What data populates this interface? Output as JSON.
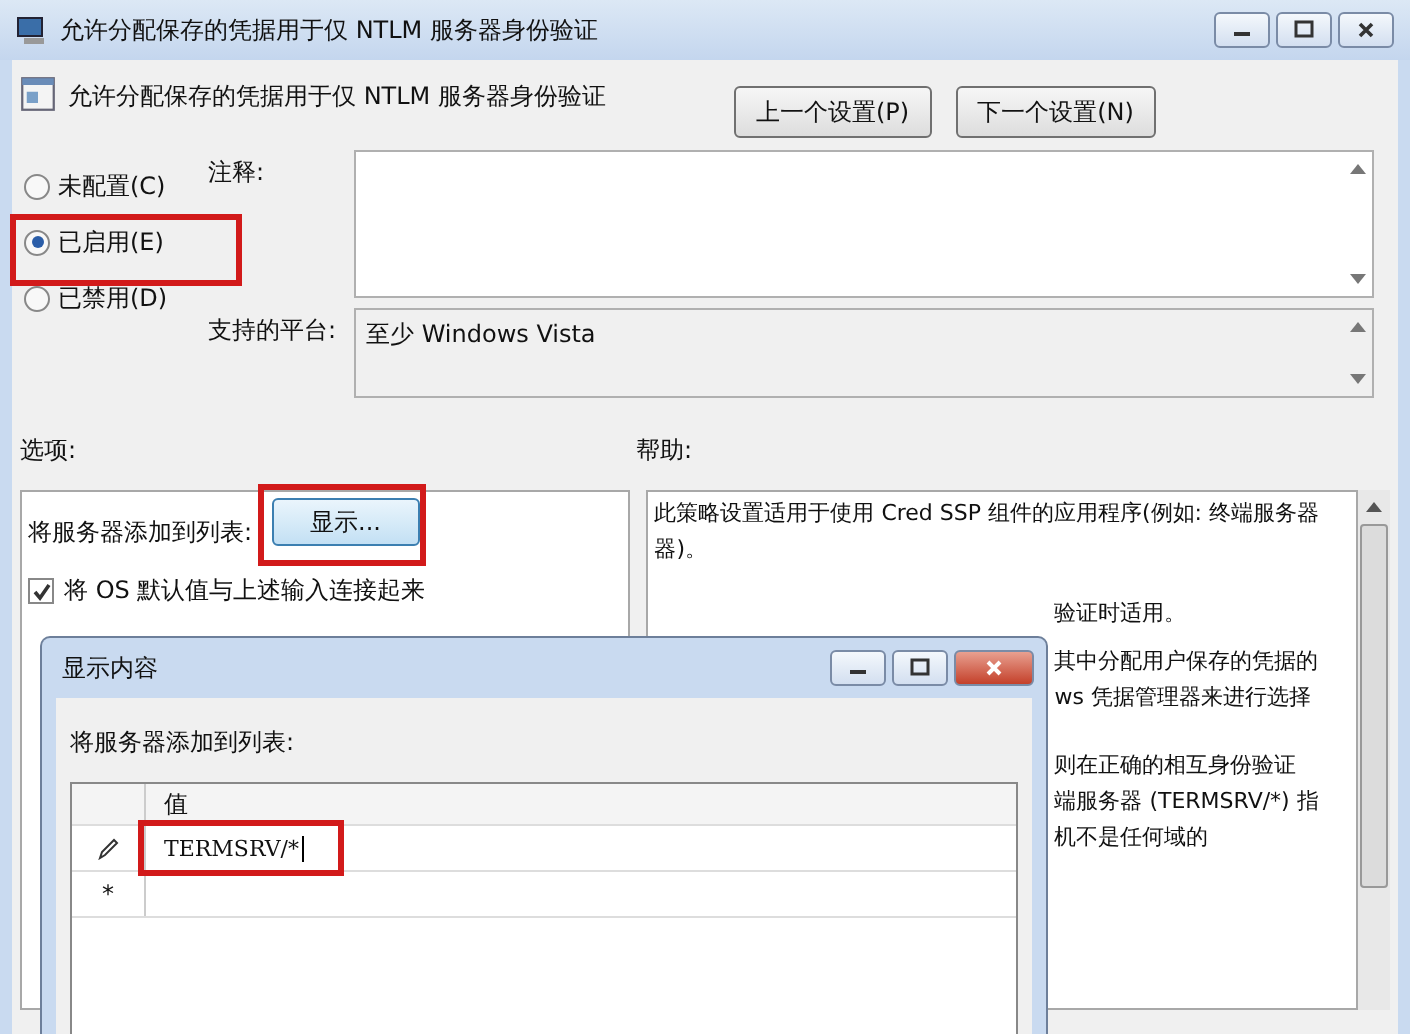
{
  "window": {
    "title": "允许分配保存的凭据用于仅 NTLM 服务器身份验证"
  },
  "header": {
    "title": "允许分配保存的凭据用于仅 NTLM 服务器身份验证",
    "buttons": [
      "上一个设置(P)",
      "下一个设置(N)"
    ]
  },
  "radios": [
    {
      "label": "未配置(C)",
      "selected": false
    },
    {
      "label": "已启用(E)",
      "selected": true
    },
    {
      "label": "已禁用(D)",
      "selected": false
    }
  ],
  "comment": {
    "label": "注释:"
  },
  "platform": {
    "label": "支持的平台:",
    "value": "至少 Windows Vista"
  },
  "options": {
    "label": "选项:",
    "add_label": "将服务器添加到列表:",
    "show_button": "显示...",
    "checkbox": {
      "label": "将 OS 默认值与上述输入连接起来",
      "checked": true
    }
  },
  "help": {
    "label": "帮助:",
    "paragraphs": [
      [
        "此策略设置适用于使用 Cred SSP 组件的应用程序(例如: 终端服务器",
        "器)。"
      ],
      [
        "验证时适用。"
      ],
      [
        "其中分配用户保存的凭据的",
        "ws 凭据管理器来进行选择"
      ],
      [
        "则在正确的相互身份验证",
        "端服务器 (TERMSRV/*) 指",
        "机不是任何域的"
      ]
    ]
  },
  "dialog": {
    "title": "显示内容",
    "label": "将服务器添加到列表:",
    "column": "值",
    "rows": [
      {
        "kind": "editing",
        "value": "TERMSRV/*"
      },
      {
        "kind": "new",
        "marker": "*"
      }
    ]
  }
}
